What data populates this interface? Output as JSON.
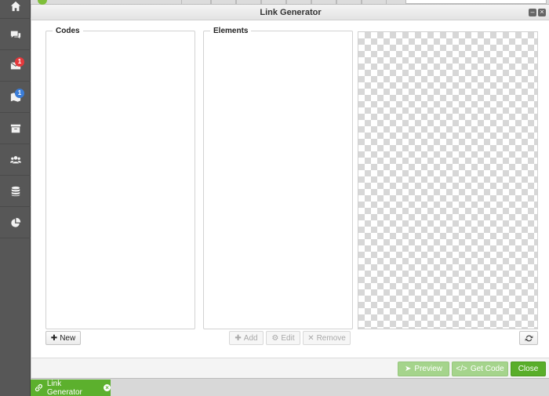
{
  "sidebar": {
    "items": [
      {
        "icon": "home-icon"
      },
      {
        "icon": "chat-icon"
      },
      {
        "icon": "inbox-icon",
        "badge": "1",
        "badge_color": "#e4393c"
      },
      {
        "icon": "map-icon",
        "badge": "1",
        "badge_color": "#3b7dd8"
      },
      {
        "icon": "archive-icon"
      },
      {
        "icon": "users-icon"
      },
      {
        "icon": "database-icon"
      },
      {
        "icon": "pie-chart-icon"
      }
    ]
  },
  "dialog": {
    "title": "Link Generator",
    "codes": {
      "legend": "Codes",
      "new_label": "New"
    },
    "elements": {
      "legend": "Elements",
      "add_label": "Add",
      "edit_label": "Edit",
      "remove_label": "Remove"
    },
    "footer": {
      "preview_label": "Preview",
      "get_code_label": "Get Code",
      "close_label": "Close"
    }
  },
  "taskbar": {
    "active_tab": "Link Generator"
  },
  "colors": {
    "accent_green": "#59ae2a",
    "light_green": "#a5d48c",
    "sidebar_bg": "#575757"
  }
}
